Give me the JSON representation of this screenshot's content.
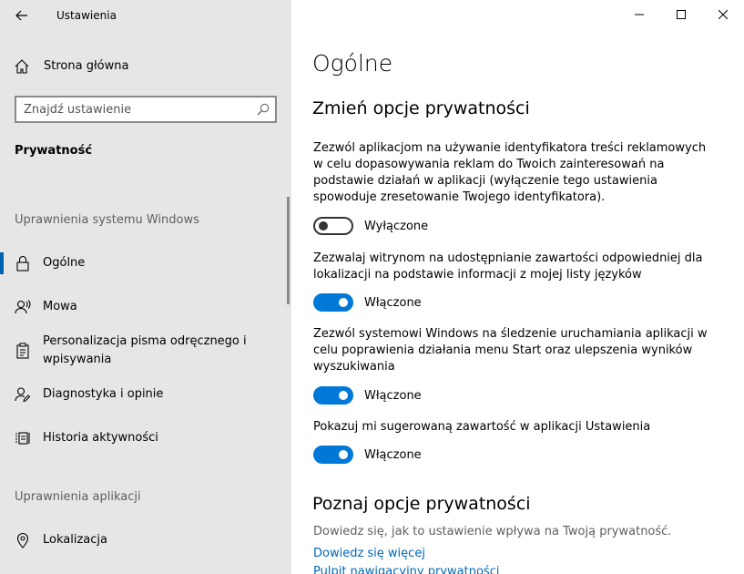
{
  "app": {
    "title": "Ustawienia"
  },
  "sidebar": {
    "home_label": "Strona główna",
    "search_placeholder": "Znajdź ustawienie",
    "section_title": "Prywatność",
    "group_windows": "Uprawnienia systemu Windows",
    "items": [
      {
        "label": "Ogólne",
        "icon": "lock-icon",
        "selected": true
      },
      {
        "label": "Mowa",
        "icon": "speech-icon"
      },
      {
        "label": "Personalizacja pisma odręcznego i wpisywania",
        "icon": "clipboard-icon"
      },
      {
        "label": "Diagnostyka i opinie",
        "icon": "feedback-icon"
      },
      {
        "label": "Historia aktywności",
        "icon": "activity-icon"
      }
    ],
    "group_apps": "Uprawnienia aplikacji",
    "app_items": [
      {
        "label": "Lokalizacja",
        "icon": "location-icon"
      }
    ]
  },
  "main": {
    "title": "Ogólne",
    "heading": "Zmień opcje prywatności",
    "settings": [
      {
        "desc": "Zezwól aplikacjom na używanie identyfikatora treści reklamowych w celu dopasowywania reklam do Twoich zainteresowań na podstawie działań w aplikacji (wyłączenie tego ustawienia spowoduje zresetowanie Twojego identyfikatora).",
        "state": "Wyłączone",
        "on": false
      },
      {
        "desc": "Zezwalaj witrynom na udostępnianie zawartości odpowiedniej dla lokalizacji na podstawie informacji z mojej listy języków",
        "state": "Włączone",
        "on": true
      },
      {
        "desc": "Zezwól systemowi Windows na śledzenie uruchamiania aplikacji w celu poprawienia działania menu Start oraz ulepszenia wyników wyszukiwania",
        "state": "Włączone",
        "on": true
      },
      {
        "desc": "Pokazuj mi sugerowaną zawartość w aplikacji Ustawienia",
        "state": "Włączone",
        "on": true
      }
    ],
    "know_heading": "Poznaj opcje prywatności",
    "know_text": "Dowiedz się, jak to ustawienie wpływa na Twoją prywatność.",
    "links": [
      "Dowiedz się więcej",
      "Pulpit nawigacyjny prywatności"
    ]
  },
  "colors": {
    "accent": "#0078d7",
    "link": "#0067b8",
    "sidebar_bg": "#e6e6e6"
  }
}
